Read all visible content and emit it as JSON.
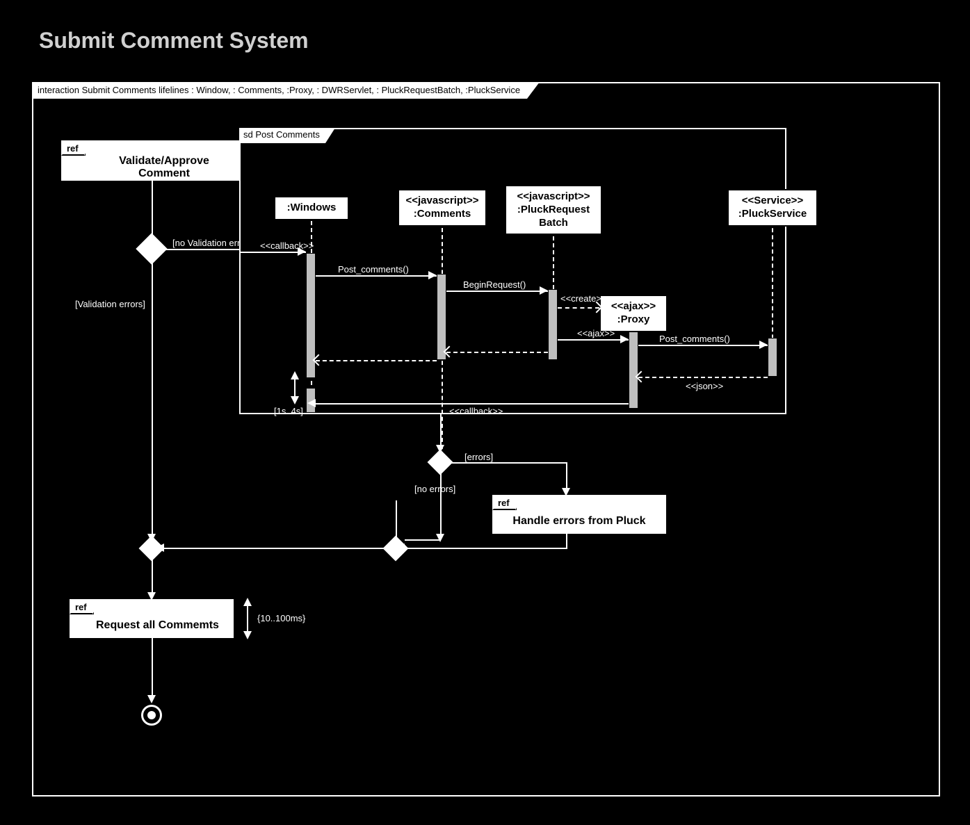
{
  "title": "Submit Comment System",
  "outer_header": "interaction Submit Comments lifelines : Window, : Comments, :Proxy, : DWRServlet, : PluckRequestBatch, :PluckService",
  "refs": {
    "validate": {
      "tag": "ref",
      "label": "Validate/Approve Comment"
    },
    "handle_errors": {
      "tag": "ref",
      "label": "Handle errors from Pluck"
    },
    "request_all": {
      "tag": "ref",
      "label": "Request all Commemts"
    }
  },
  "sd": {
    "tag": "sd Post Comments",
    "lifelines": {
      "windows": ":Windows",
      "comments": "<<javascript>>\n:Comments",
      "batch": "<<javascript>>\n:PluckRequest\nBatch",
      "proxy": "<<ajax>>\n:Proxy",
      "service": "<<Service>>\n:PluckService"
    }
  },
  "messages": {
    "callback_in": "<<callback>>",
    "post_comments": "Post_comments()",
    "begin_request": "BeginRequest()",
    "create": "<<create>>",
    "ajax": "<<ajax>>",
    "post_comments2": "Post_comments()",
    "json": "<<json>>",
    "callback_back": "<<callback>>"
  },
  "guards": {
    "no_validation": "[no Validation errors]",
    "validation": "[Validation errors]",
    "errors": "[errors]",
    "no_errors": "[no errors]"
  },
  "timings": {
    "sd_delay": "[1s..4s]",
    "request_all": "{10..100ms}"
  }
}
